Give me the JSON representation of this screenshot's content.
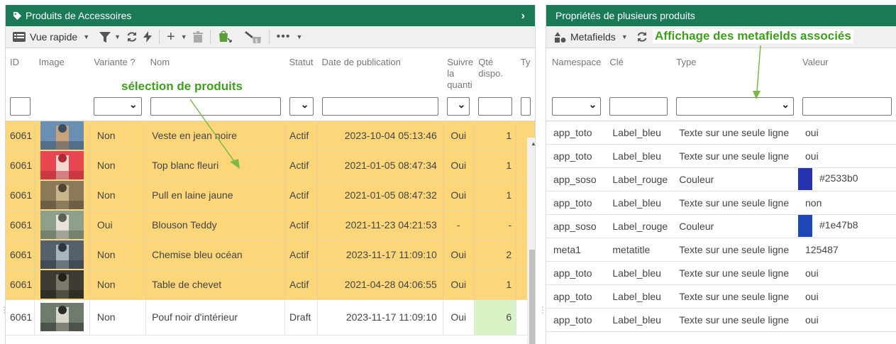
{
  "left": {
    "title": "Produits de Accessoires",
    "toolbar": {
      "view_label": "Vue rapide"
    },
    "columns": [
      "ID",
      "Image",
      "Variante ?",
      "Nom",
      "Statut",
      "Date de publication",
      "Suivre la quanti",
      "Qté dispo.",
      "Ty"
    ],
    "rows": [
      {
        "id": "6061",
        "variante": "Non",
        "nom": "Veste en jean noire",
        "statut": "Actif",
        "date": "2023-10-04 05:13:46",
        "suivre": "Oui",
        "qte": "1",
        "img": [
          "#6b8fb3",
          "#c9a27a",
          "#3b4d5e"
        ]
      },
      {
        "id": "6061",
        "variante": "Non",
        "nom": "Top blanc fleuri",
        "statut": "Actif",
        "date": "2021-01-05 08:47:34",
        "suivre": "Oui",
        "qte": "1",
        "img": [
          "#e9474f",
          "#f3d7cf",
          "#b02a35"
        ]
      },
      {
        "id": "6061",
        "variante": "Non",
        "nom": "Pull en laine jaune",
        "statut": "Actif",
        "date": "2021-01-05 08:47:32",
        "suivre": "Oui",
        "qte": "1",
        "img": [
          "#8a7a5a",
          "#c9b58a",
          "#4f4433"
        ]
      },
      {
        "id": "6061",
        "variante": "Oui",
        "nom": "Blouson Teddy",
        "statut": "Actif",
        "date": "2021-11-23 04:21:53",
        "suivre": "-",
        "qte": "-",
        "img": [
          "#8fa08a",
          "#e8e2da",
          "#5b6356"
        ]
      },
      {
        "id": "6061",
        "variante": "Non",
        "nom": "Chemise bleu océan",
        "statut": "Actif",
        "date": "2023-11-17 11:09:10",
        "suivre": "Oui",
        "qte": "2",
        "img": [
          "#55606a",
          "#a9b4bd",
          "#2e353b"
        ]
      },
      {
        "id": "6061",
        "variante": "Non",
        "nom": "Table de chevet",
        "statut": "Actif",
        "date": "2021-04-28 04:06:55",
        "suivre": "Oui",
        "qte": "1",
        "img": [
          "#3d3b33",
          "#7d7a6b",
          "#22211c"
        ]
      },
      {
        "id": "6061",
        "variante": "Non",
        "nom": "Pouf noir d'intérieur",
        "statut": "Draft",
        "date": "2023-11-17 11:09:10",
        "suivre": "Oui",
        "qte": "6",
        "img": [
          "#6f7b6e",
          "#d9d6cc",
          "#2a2c28"
        ]
      }
    ],
    "annotation": "sélection de produits"
  },
  "right": {
    "title": "Propriétés de plusieurs produits",
    "toolbar": {
      "metafields_label": "Metafields"
    },
    "columns": [
      "Namespace",
      "Clé",
      "Type",
      "Valeur"
    ],
    "rows": [
      {
        "ns": "app_toto",
        "cle": "Label_bleu",
        "type": "Texte sur une seule ligne",
        "valeur": "oui",
        "color": ""
      },
      {
        "ns": "app_toto",
        "cle": "Label_bleu",
        "type": "Texte sur une seule ligne",
        "valeur": "oui",
        "color": ""
      },
      {
        "ns": "app_soso",
        "cle": "Label_rouge",
        "type": "Couleur",
        "valeur": "#2533b0",
        "color": "#2533b0"
      },
      {
        "ns": "app_toto",
        "cle": "Label_bleu",
        "type": "Texte sur une seule ligne",
        "valeur": "non",
        "color": ""
      },
      {
        "ns": "app_soso",
        "cle": "Label_rouge",
        "type": "Couleur",
        "valeur": "#1e47b8",
        "color": "#1e47b8"
      },
      {
        "ns": "meta1",
        "cle": "metatitle",
        "type": "Texte sur une seule ligne",
        "valeur": "125487",
        "color": ""
      },
      {
        "ns": "app_toto",
        "cle": "Label_bleu",
        "type": "Texte sur une seule ligne",
        "valeur": "oui",
        "color": ""
      },
      {
        "ns": "app_toto",
        "cle": "Label_bleu",
        "type": "Texte sur une seule ligne",
        "valeur": "oui",
        "color": ""
      },
      {
        "ns": "app_toto",
        "cle": "Label_bleu",
        "type": "Texte sur une seule ligne",
        "valeur": "oui",
        "color": ""
      }
    ],
    "annotation": "Affichage des metafields associés"
  },
  "colors": {
    "header_green": "#1b7a56",
    "selected_row": "#fdd67a",
    "annotation_green": "#3f9e1e",
    "qty_green": "#d9f3c7"
  }
}
